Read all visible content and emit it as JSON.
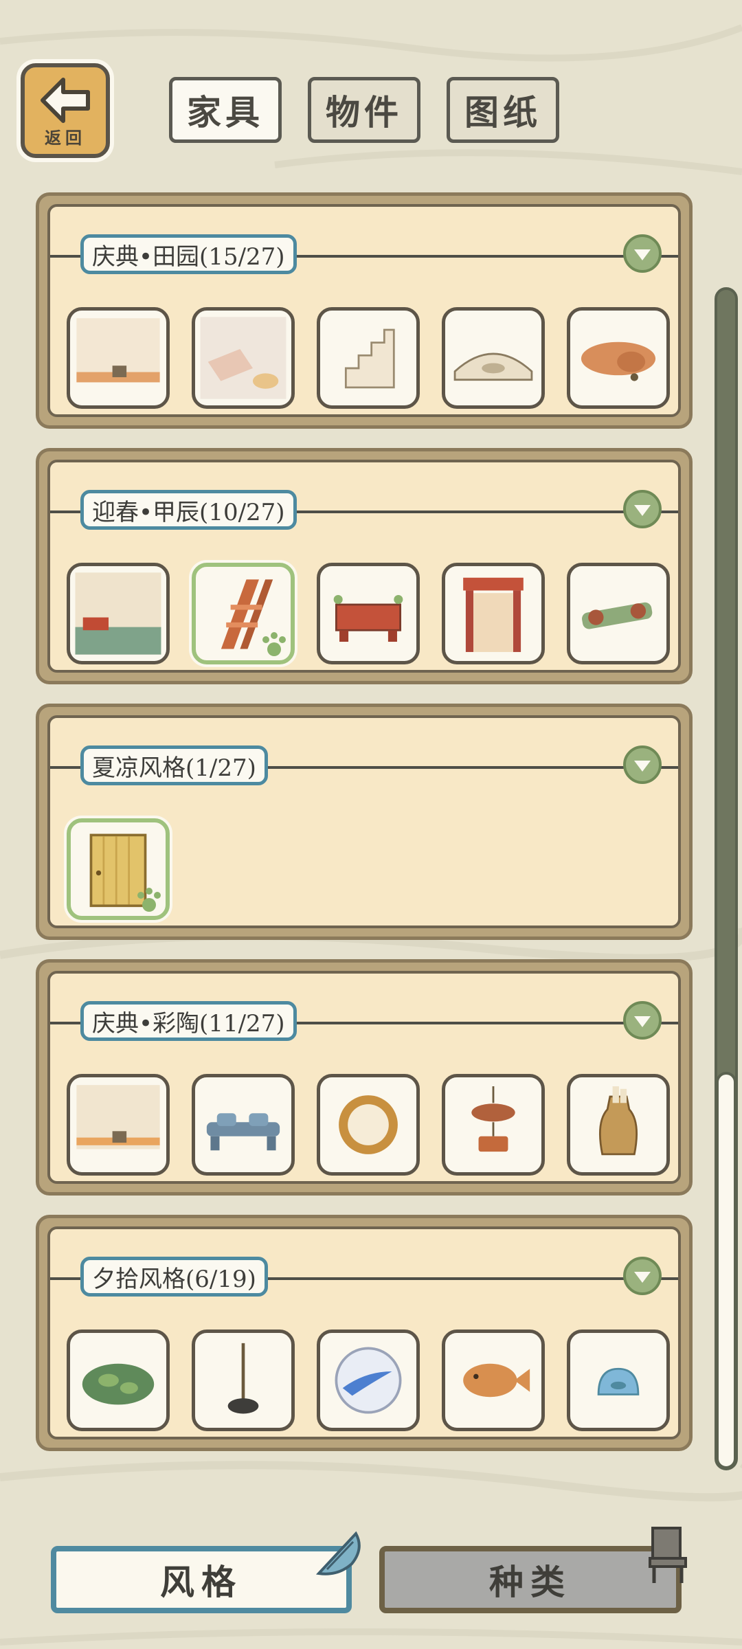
{
  "header": {
    "back_label": "返回",
    "tabs": [
      {
        "label": "家具",
        "active": true
      },
      {
        "label": "物件",
        "active": false
      },
      {
        "label": "图纸",
        "active": false
      }
    ]
  },
  "panels": [
    {
      "title": "庆典•田园(15/27)"
    },
    {
      "title": "迎春•甲辰(10/27)"
    },
    {
      "title": "夏凉风格(1/27)"
    },
    {
      "title": "庆典•彩陶(11/27)"
    },
    {
      "title": "夕拾风格(6/19)"
    }
  ],
  "bottom": {
    "style_label": "风格",
    "type_label": "种类"
  },
  "colors": {
    "background": "#e6e2cf",
    "panel_fill": "#f8e8c6",
    "active_border": "#4f8aa0",
    "owned_border": "#9fc27d"
  }
}
